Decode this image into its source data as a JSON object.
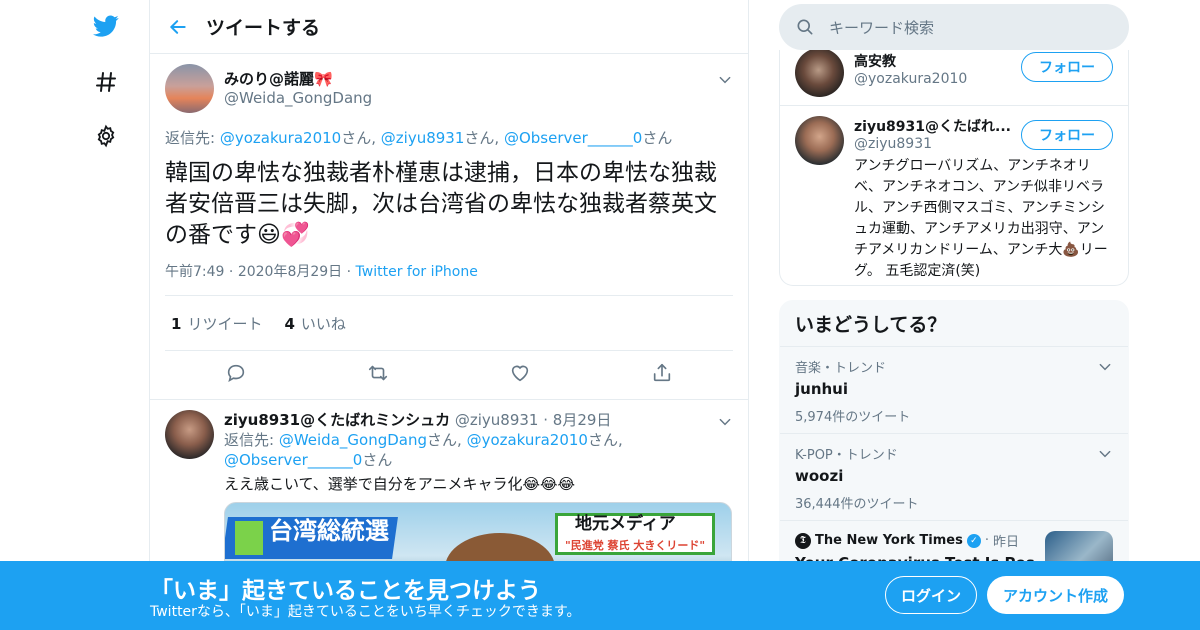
{
  "header": {
    "title": "ツイートする"
  },
  "search": {
    "placeholder": "キーワード検索"
  },
  "main_tweet": {
    "display_name": "みのり@諾麗🎀",
    "handle": "@Weida_GongDang",
    "reply_prefix": "返信先: ",
    "reply_to": [
      "@yozakura2010",
      "@ziyu8931",
      "@Observer______0"
    ],
    "reply_suffix": "さん",
    "text": "韓国の卑怯な独裁者朴槿恵は逮捕，日本の卑怯な独裁者安倍晋三は失脚，次は台湾省の卑怯な独裁者蔡英文の番です😃💞",
    "time": "午前7:49",
    "date": "2020年8月29日",
    "source": "Twitter for iPhone",
    "retweet_count": "1",
    "retweet_label": "リツイート",
    "like_count": "4",
    "like_label": "いいね"
  },
  "reply_tweet": {
    "display_name": "ziyu8931@くたばれミンシュカ",
    "handle": "@ziyu8931",
    "date": "8月29日",
    "reply_prefix": "返信先: ",
    "reply_to": [
      "@Weida_GongDang",
      "@yozakura2010",
      "@Observer______0"
    ],
    "reply_suffix": "さん",
    "text": "ええ歳こいて、選挙で自分をアニメキャラ化😂😂😂",
    "media_caption_left": "台湾総統選",
    "media_caption_right": "地元メディア",
    "media_caption_right_sub": "\"民進党 蔡氏 大きくリード\""
  },
  "who_to_follow": [
    {
      "display_name": "高安教",
      "handle": "@yozakura2010",
      "follow_label": "フォロー"
    },
    {
      "display_name": "ziyu8931@くたばれ...",
      "handle": "@ziyu8931",
      "follow_label": "フォロー",
      "bio": "アンチグローバリズム、アンチネオリベ、アンチネオコン、アンチ似非リベラル、アンチ西側マスゴミ、アンチミンシュカ運動、アンチアメリカ出羽守、アンチアメリカンドリーム、アンチ大💩リーグ。 五毛認定済(笑)"
    }
  ],
  "trends": {
    "title": "いまどうしてる？",
    "items": [
      {
        "context": "音楽・トレンド",
        "name": "junhui",
        "count": "5,974件のツイート"
      },
      {
        "context": "K-POP・トレンド",
        "name": "woozi",
        "count": "36,444件のツイート"
      }
    ],
    "news": {
      "source": "The New York Times",
      "time": "昨日",
      "headline": "Your Coronavirus Test Is Positive..."
    }
  },
  "banner": {
    "title": "「いま」起きていることを見つけよう",
    "subtitle": "Twitterなら、「いま」起きていることをいち早くチェックできます。",
    "login": "ログイン",
    "signup": "アカウント作成"
  },
  "colors": {
    "brand": "#1da1f2",
    "text": "#14171a",
    "secondary": "#657786",
    "border": "#e6ecf0"
  }
}
